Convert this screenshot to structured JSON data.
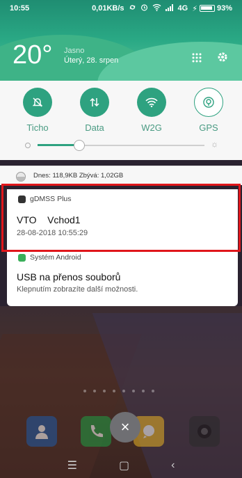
{
  "status_bar": {
    "time": "10:55",
    "speed": "0,01KB/s",
    "network": "4G",
    "battery": "93%"
  },
  "weather": {
    "temperature": "20°",
    "condition": "Jasno",
    "date": "Úterý, 28. srpen"
  },
  "quick_settings": [
    {
      "label": "Ticho",
      "icon": "silent-bell-icon",
      "state": "on"
    },
    {
      "label": "Data",
      "icon": "data-transfer-icon",
      "state": "on"
    },
    {
      "label": "W2G",
      "icon": "wifi-icon",
      "state": "on"
    },
    {
      "label": "GPS",
      "icon": "gps-icon",
      "state": "off"
    }
  ],
  "brightness": {
    "level": 0.25
  },
  "data_usage": {
    "text": "Dnes: 118,9KB  Zbývá: 1,02GB"
  },
  "notifications": [
    {
      "app": "gDMSS Plus",
      "title": "VTO    Vchod1",
      "text": "28-08-2018 10:55:29"
    },
    {
      "app": "Systém Android",
      "title": "USB na přenos souborů",
      "text": "Klepnutím zobrazíte další možnosti."
    }
  ],
  "nav": {
    "menu": "☰",
    "home": "▢",
    "back": "‹"
  },
  "dismiss_label": "×",
  "colors": {
    "accent": "#2ea280",
    "highlight": "#e0161b"
  }
}
